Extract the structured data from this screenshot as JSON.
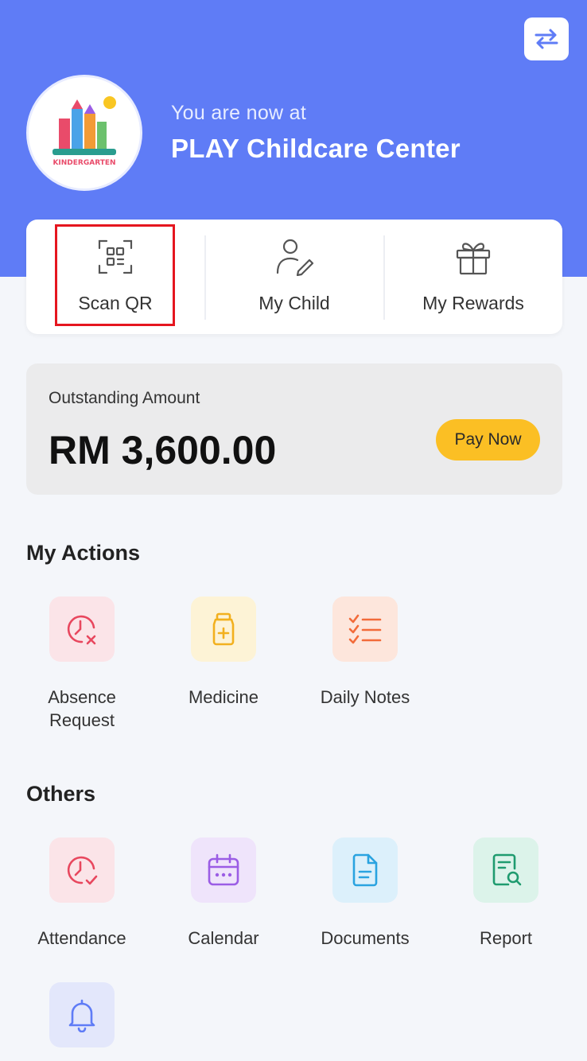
{
  "header": {
    "switch_icon": "swap-arrows-icon",
    "logo_text": "KINDERGARTEN",
    "welcome_text": "You are now at",
    "center_name": "PLAY Childcare Center",
    "background": "#5f7cf6"
  },
  "quick_actions": [
    {
      "label": "Scan QR",
      "icon": "qr-scan-icon"
    },
    {
      "label": "My Child",
      "icon": "child-profile-icon"
    },
    {
      "label": "My Rewards",
      "icon": "gift-icon"
    }
  ],
  "billing": {
    "label": "Outstanding Amount",
    "amount": "RM 3,600.00",
    "pay_label": "Pay Now",
    "pay_color": "#fbbf24"
  },
  "my_actions": {
    "title": "My Actions",
    "items": [
      {
        "label": "Absence Request",
        "icon": "clock-cancel-icon",
        "bg": "#fbe4e8",
        "fg": "#e8475e"
      },
      {
        "label": "Medicine",
        "icon": "medicine-bottle-icon",
        "bg": "#fdf3d6",
        "fg": "#f2b01e"
      },
      {
        "label": "Daily Notes",
        "icon": "checklist-icon",
        "bg": "#fde6dc",
        "fg": "#f26b3a"
      }
    ]
  },
  "others": {
    "title": "Others",
    "items": [
      {
        "label": "Attendance",
        "icon": "clock-check-icon",
        "bg": "#fbe4e8",
        "fg": "#e8475e"
      },
      {
        "label": "Calendar",
        "icon": "calendar-icon",
        "bg": "#efe4fb",
        "fg": "#9b5de5"
      },
      {
        "label": "Documents",
        "icon": "document-icon",
        "bg": "#dcf0fb",
        "fg": "#2aa3e0"
      },
      {
        "label": "Report",
        "icon": "report-search-icon",
        "bg": "#dcf3ea",
        "fg": "#1f9b6f"
      },
      {
        "label": "",
        "icon": "bell-icon",
        "bg": "#e3e7fb",
        "fg": "#5f7cf6"
      }
    ]
  }
}
